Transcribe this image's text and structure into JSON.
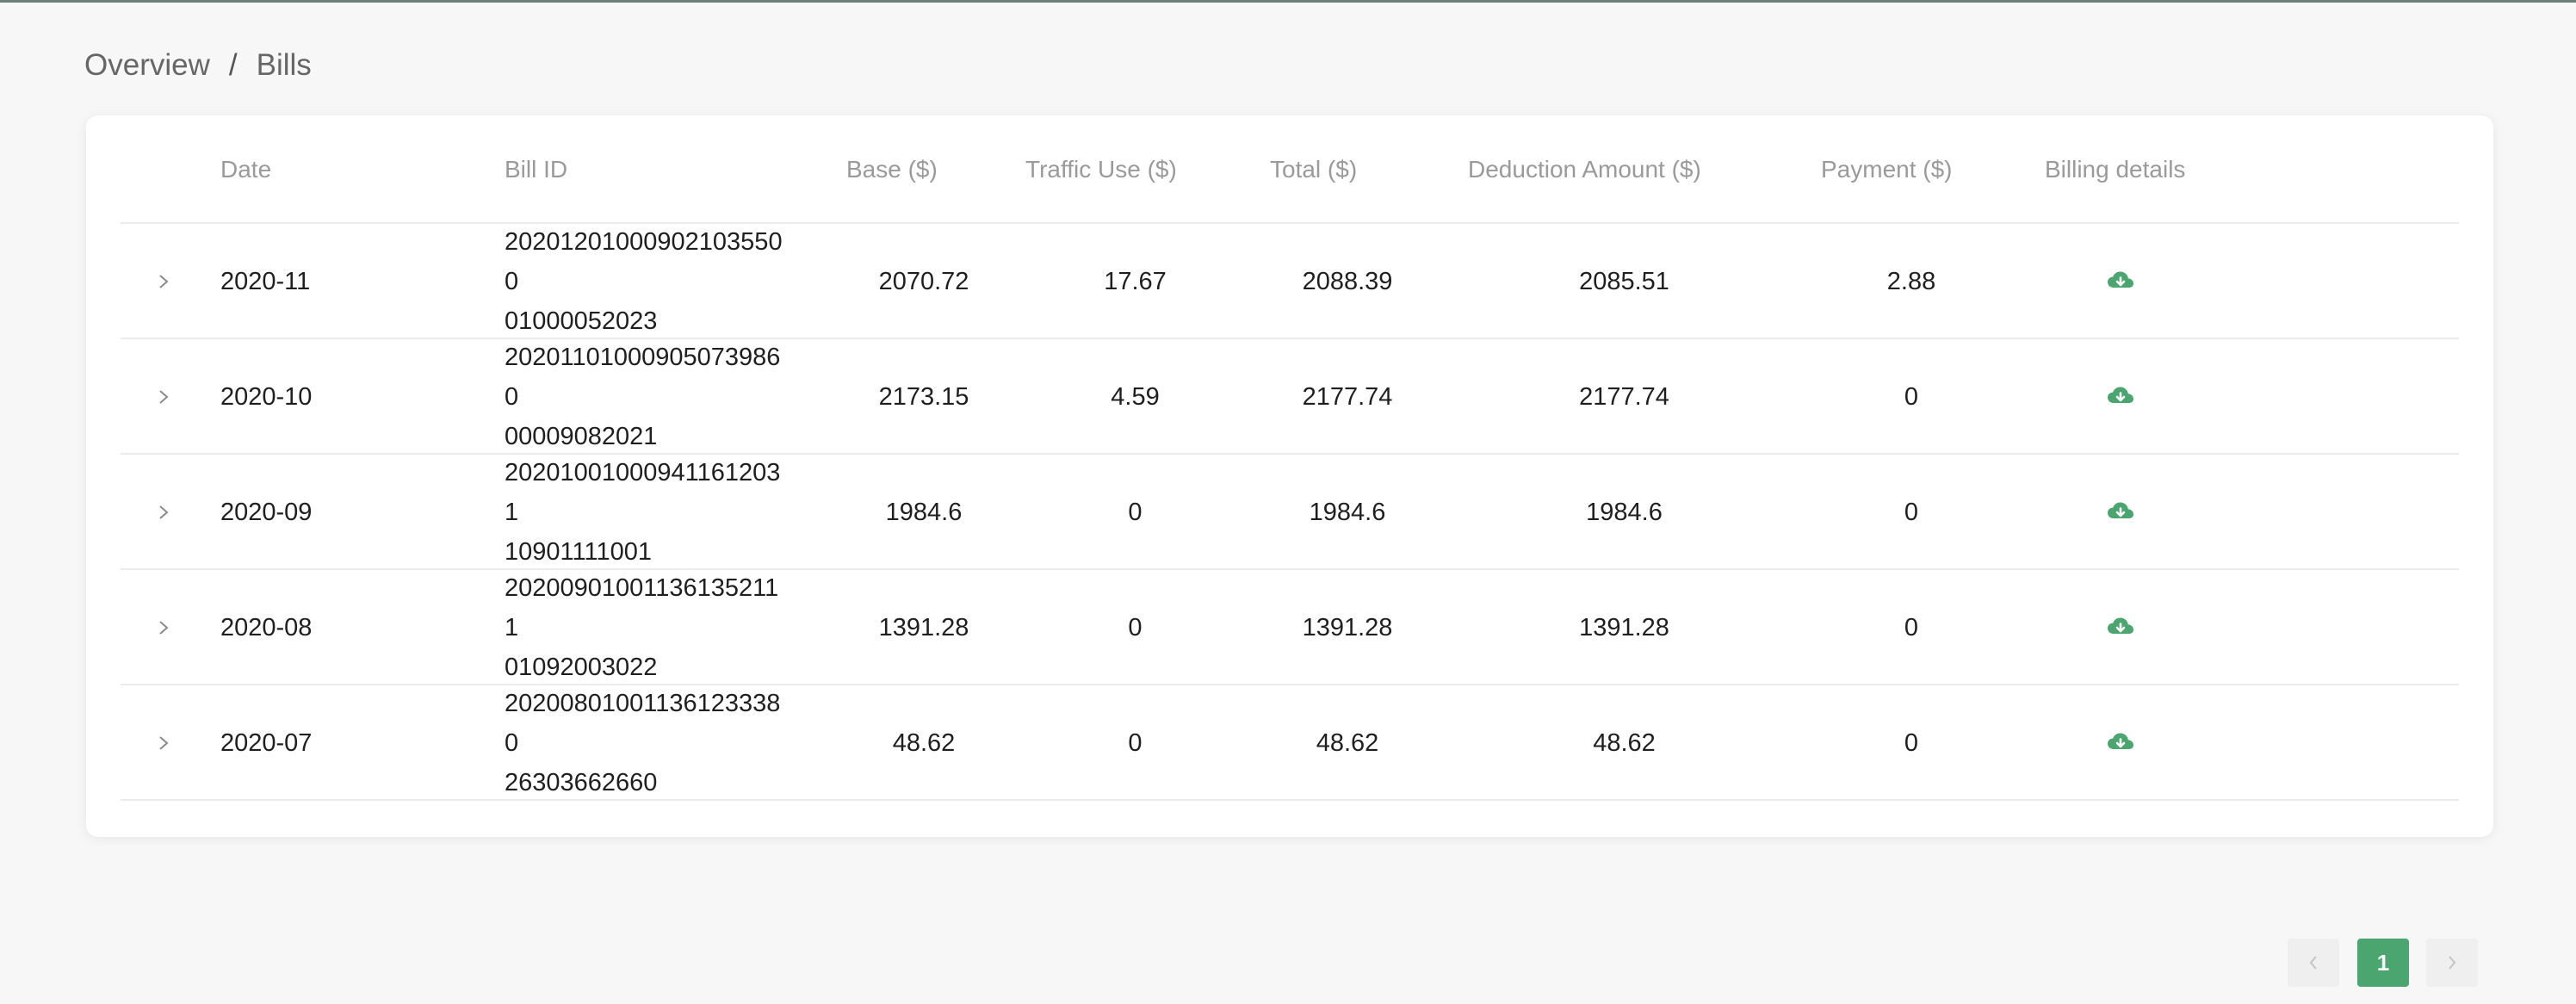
{
  "breadcrumb": {
    "parent": "Overview",
    "separator": "/",
    "current": "Bills"
  },
  "table": {
    "columns": [
      "Date",
      "Bill ID",
      "Base ($)",
      "Traffic Use ($)",
      "Total ($)",
      "Deduction Amount ($)",
      "Payment ($)",
      "Billing details"
    ],
    "rows": [
      {
        "date": "2020-11",
        "bill_id_1": "202012010009021035500",
        "bill_id_2": "01000052023",
        "base": "2070.72",
        "traffic": "17.67",
        "total": "2088.39",
        "deduction": "2085.51",
        "payment": "2.88"
      },
      {
        "date": "2020-10",
        "bill_id_1": "202011010009050739860",
        "bill_id_2": "00009082021",
        "base": "2173.15",
        "traffic": "4.59",
        "total": "2177.74",
        "deduction": "2177.74",
        "payment": "0"
      },
      {
        "date": "2020-09",
        "bill_id_1": "202010010009411612031",
        "bill_id_2": "10901111001",
        "base": "1984.6",
        "traffic": "0",
        "total": "1984.6",
        "deduction": "1984.6",
        "payment": "0"
      },
      {
        "date": "2020-08",
        "bill_id_1": "202009010011361352111",
        "bill_id_2": "01092003022",
        "base": "1391.28",
        "traffic": "0",
        "total": "1391.28",
        "deduction": "1391.28",
        "payment": "0"
      },
      {
        "date": "2020-07",
        "bill_id_1": "202008010011361233380",
        "bill_id_2": "26303662660",
        "base": "48.62",
        "traffic": "0",
        "total": "48.62",
        "deduction": "48.62",
        "payment": "0"
      }
    ]
  },
  "icons": {
    "expand": "chevron-right-icon",
    "download": "cloud-download-icon",
    "prev": "chevron-left-icon",
    "next": "chevron-right-icon"
  },
  "colors": {
    "accent": "#4aa56f"
  },
  "pagination": {
    "current_page": "1"
  }
}
